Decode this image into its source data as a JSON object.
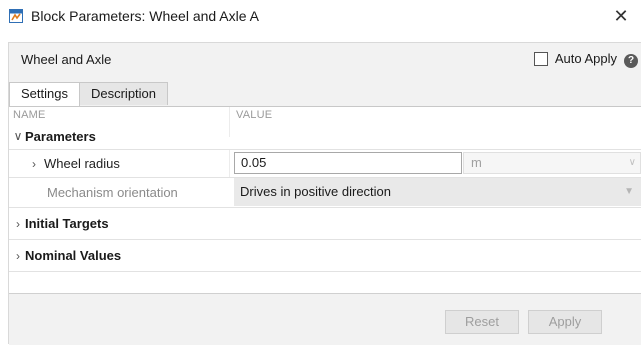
{
  "window": {
    "title": "Block Parameters: Wheel and Axle A",
    "close_glyph": "✕",
    "icon": "simulink-block-icon"
  },
  "header": {
    "block_name": "Wheel and Axle",
    "auto_apply_label": "Auto Apply",
    "auto_apply_checked": false,
    "help_glyph": "?"
  },
  "tabs": [
    {
      "label": "Settings",
      "active": true
    },
    {
      "label": "Description",
      "active": false
    }
  ],
  "table": {
    "col_name": "NAME",
    "col_value": "VALUE",
    "sections": {
      "parameters": "Parameters",
      "initial_targets": "Initial Targets",
      "nominal_values": "Nominal Values"
    },
    "wheel_radius": {
      "label": "Wheel radius",
      "value": "0.05",
      "unit": "m"
    },
    "mechanism_orientation": {
      "label": "Mechanism orientation",
      "value": "Drives in positive direction"
    }
  },
  "footer": {
    "reset_label": "Reset",
    "apply_label": "Apply"
  },
  "colors": {
    "panel_bg": "#f2f2f2",
    "disabled_text": "#9e9e9e"
  }
}
